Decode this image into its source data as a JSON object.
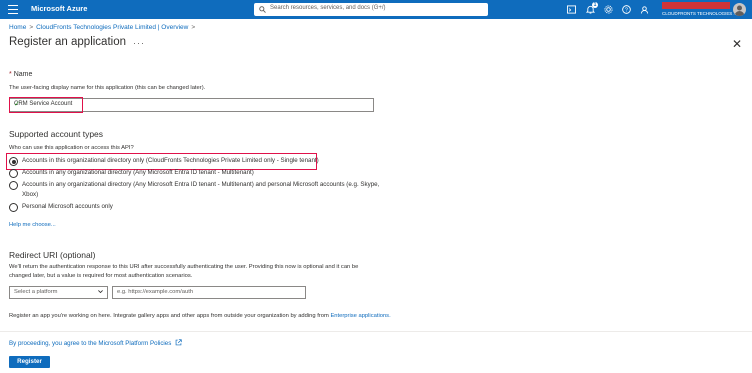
{
  "header": {
    "brand": "Microsoft Azure",
    "search_placeholder": "Search resources, services, and docs (G+/)",
    "notification_count": "1",
    "tenant": "CLOUDFRONTS TECHNOLOGIES ...",
    "accent": "#0f6cbd"
  },
  "breadcrumb": {
    "home": "Home",
    "tenant_overview": "CloudFronts Technologies Private Limited | Overview"
  },
  "page": {
    "title": "Register an application",
    "more": "···"
  },
  "name_section": {
    "required_mark": "*",
    "label": "Name",
    "help": "The user-facing display name for this application (this can be changed later).",
    "value": "CRM Service Account"
  },
  "account_types": {
    "heading": "Supported account types",
    "question": "Who can use this application or access this API?",
    "options": [
      "Accounts in this organizational directory only (CloudFronts Technologies Private Limited only - Single tenant)",
      "Accounts in any organizational directory (Any Microsoft Entra ID tenant - Multitenant)",
      "Accounts in any organizational directory (Any Microsoft Entra ID tenant - Multitenant) and personal Microsoft accounts (e.g. Skype,",
      "Xbox)",
      "Personal Microsoft accounts only"
    ],
    "selected_index": 0,
    "help_link": "Help me choose..."
  },
  "redirect": {
    "heading": "Redirect URI (optional)",
    "desc_line1": "We'll return the authentication response to this URI after successfully authenticating the user. Providing this now is optional and it can be",
    "desc_line2": "changed later, but a value is required for most authentication scenarios.",
    "platform_placeholder": "Select a platform",
    "uri_placeholder": "e.g. https://example.com/auth"
  },
  "footer": {
    "register_note": "Register an app you're working on here. Integrate gallery apps and other apps from outside your organization by adding from",
    "enterprise_link": "Enterprise applications.",
    "policy": "By proceeding, you agree to the Microsoft Platform Policies",
    "register_button": "Register"
  }
}
